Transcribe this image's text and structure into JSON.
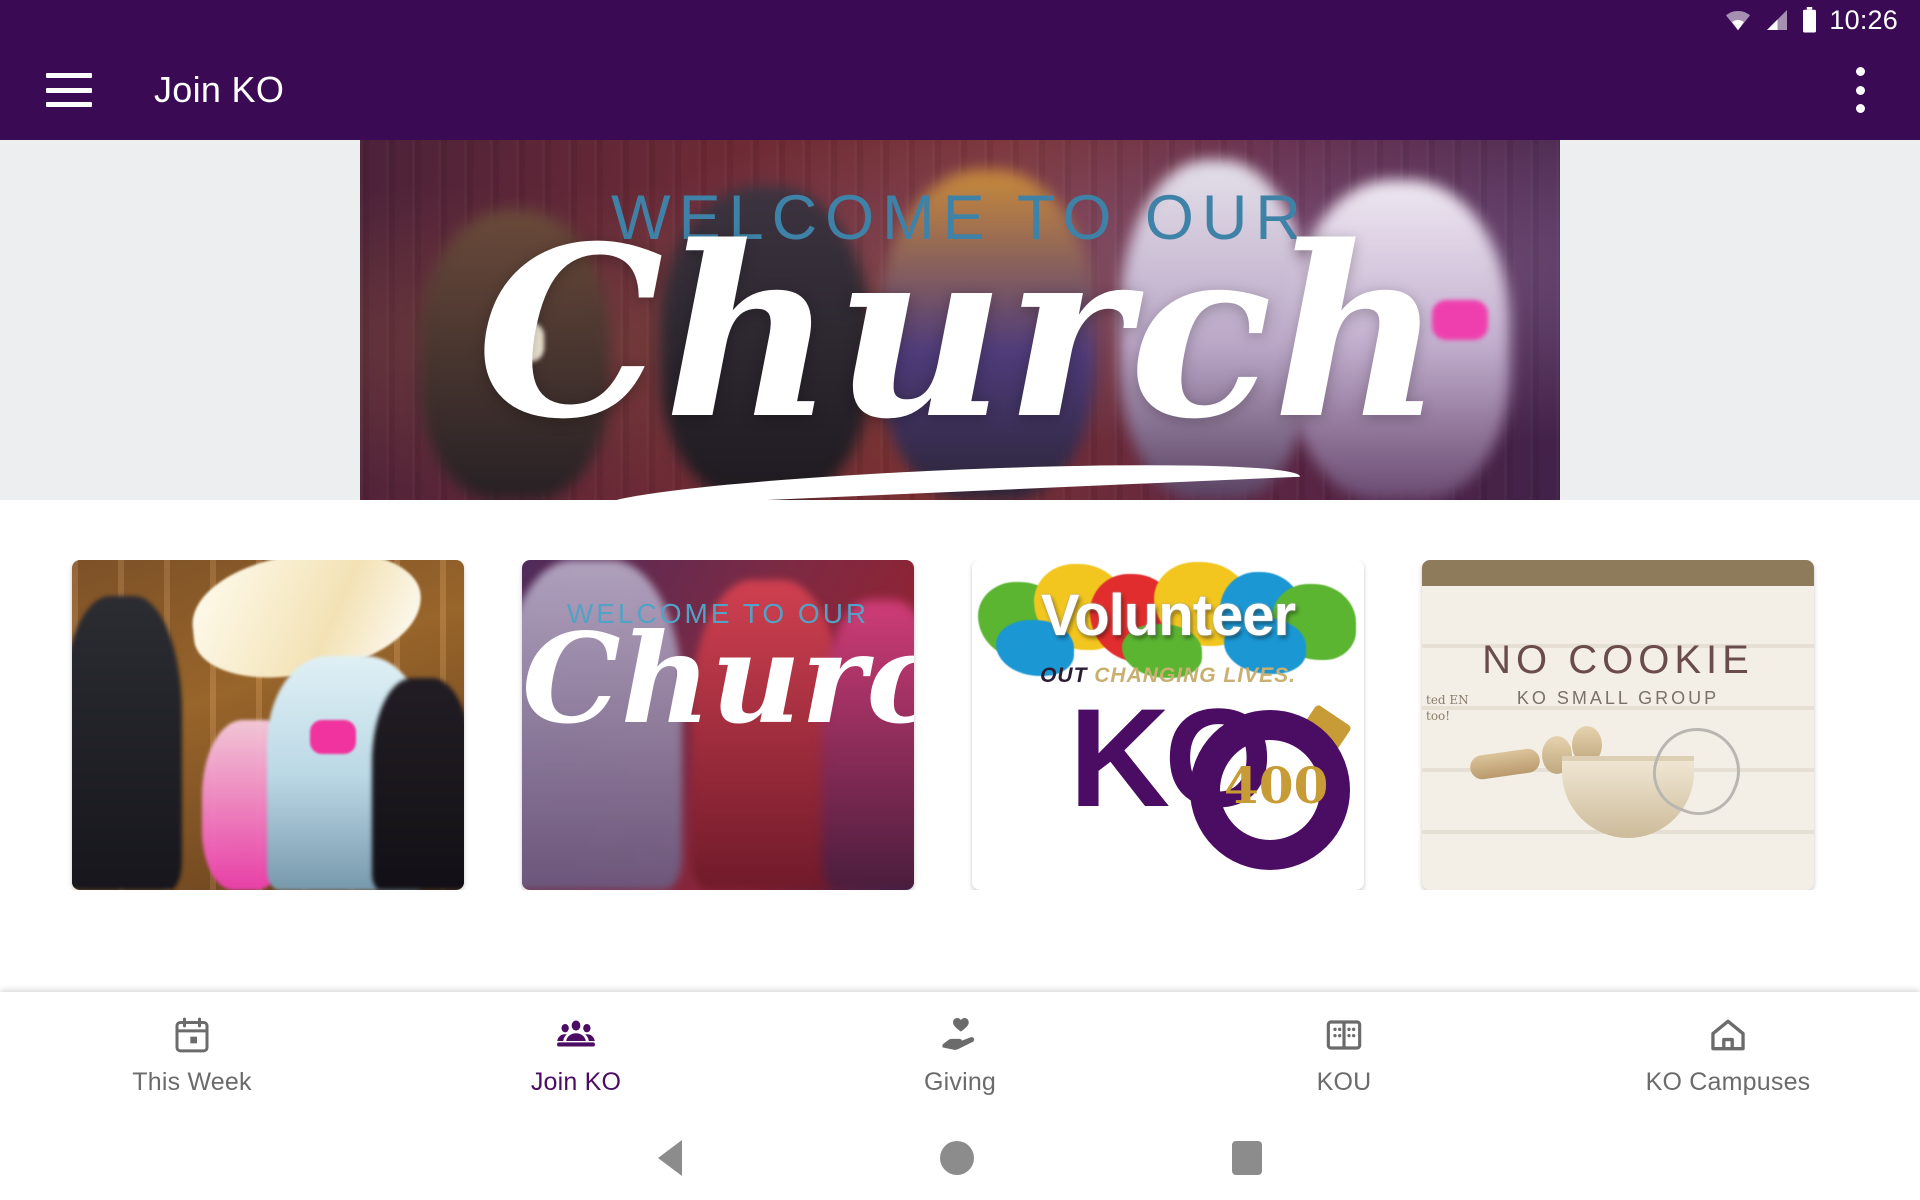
{
  "status_bar": {
    "time": "10:26",
    "icons": [
      "wifi-icon",
      "cellular-signal-icon",
      "battery-icon"
    ]
  },
  "app_bar": {
    "menu_icon": "hamburger-menu-icon",
    "title": "Join KO",
    "overflow_icon": "overflow-menu-icon",
    "background_color": "#3b0a55"
  },
  "hero": {
    "kicker": "WELCOME TO OUR",
    "script": "Church",
    "kicker_color": "#3f82a8",
    "script_color": "#ffffff"
  },
  "cards": [
    {
      "name": "worship-flags",
      "kicker": "",
      "script": "",
      "title": "",
      "subtitle": ""
    },
    {
      "name": "welcome-to-our-church",
      "kicker": "WELCOME TO OUR",
      "script": "Church",
      "title": "",
      "subtitle": ""
    },
    {
      "name": "volunteer-ko-400",
      "headline": "Volunteer",
      "tagline_lead": "OUT",
      "tagline_rest": "CHANGING LIVES.",
      "logo_text": "KO",
      "logo_number": "400"
    },
    {
      "name": "no-cookie-small-group",
      "title": "NO COOKIE",
      "subtitle": "KO SMALL GROUP",
      "note": "ted EN too!"
    }
  ],
  "bottom_nav": {
    "active_index": 1,
    "active_color": "#4a0d63",
    "inactive_color": "#6b6b6b",
    "items": [
      {
        "label": "This Week",
        "icon": "calendar-icon"
      },
      {
        "label": "Join KO",
        "icon": "people-group-icon"
      },
      {
        "label": "Giving",
        "icon": "hand-heart-icon"
      },
      {
        "label": "KOU",
        "icon": "open-book-icon"
      },
      {
        "label": "KO Campuses",
        "icon": "home-icon"
      }
    ]
  },
  "system_nav": {
    "back": "back-triangle-icon",
    "home": "home-circle-icon",
    "recents": "recents-square-icon"
  }
}
